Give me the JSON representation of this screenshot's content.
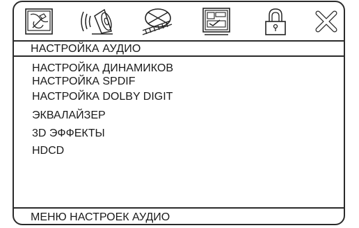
{
  "tabs": [
    {
      "icon": "general-setup-icon"
    },
    {
      "icon": "audio-speaker-icon"
    },
    {
      "icon": "video-disc-icon"
    },
    {
      "icon": "preference-screen-icon"
    },
    {
      "icon": "lock-icon"
    },
    {
      "icon": "exit-icon"
    }
  ],
  "section_title": "НАСТРОЙКА АУДИО",
  "menu": [
    {
      "label": "НАСТРОЙКА ДИНАМИКОВ"
    },
    {
      "label": "НАСТРОЙКА SPDIF"
    },
    {
      "label": "НАСТРОЙКА DOLBY DIGIT"
    },
    {
      "label": "ЭКВАЛАЙЗЕР"
    },
    {
      "label": "3D ЭФФЕКТЫ"
    },
    {
      "label": "HDCD"
    }
  ],
  "footer": "МЕНЮ НАСТРОЕК АУДИО"
}
